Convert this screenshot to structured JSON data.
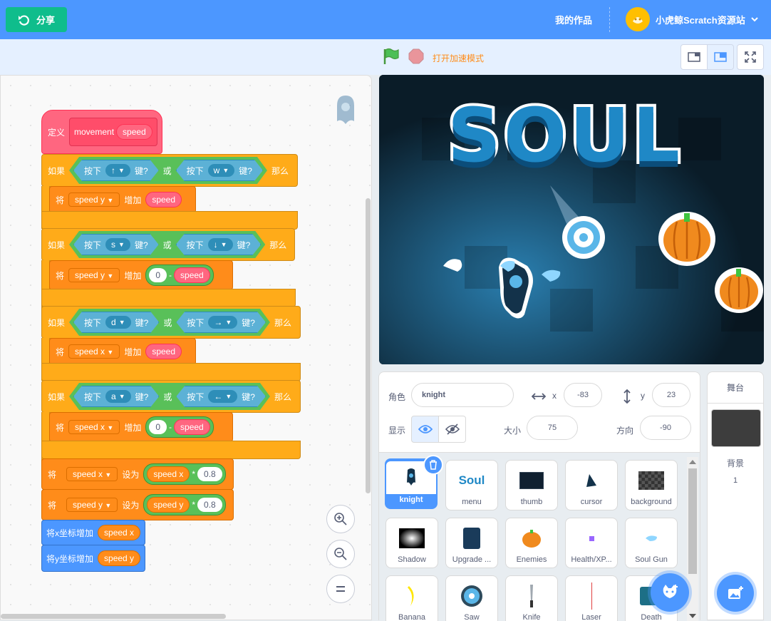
{
  "topbar": {
    "share_label": "分享",
    "my_works_label": "我的作品",
    "username": "小虎鲸Scratch资源站"
  },
  "controls": {
    "turbo_label": "打开加速模式"
  },
  "code": {
    "define": {
      "label": "定义",
      "name": "movement",
      "param": "speed"
    },
    "if1": {
      "if": "如果",
      "press": "按下",
      "key1": "↑",
      "key_word": "键?",
      "or": "或",
      "press2": "按下",
      "key2": "w",
      "key_word2": "键?",
      "then": "那么"
    },
    "change1": {
      "set": "将",
      "var": "speed y",
      "op": "增加",
      "value": "speed"
    },
    "if2": {
      "if": "如果",
      "press": "按下",
      "key1": "s",
      "key_word": "键?",
      "or": "或",
      "press2": "按下",
      "key2": "↓",
      "key_word2": "键?",
      "then": "那么"
    },
    "change2": {
      "set": "将",
      "var": "speed y",
      "op": "增加",
      "num": "0",
      "minus": "-",
      "value": "speed"
    },
    "if3": {
      "if": "如果",
      "press": "按下",
      "key1": "d",
      "key_word": "键?",
      "or": "或",
      "press2": "按下",
      "key2": "→",
      "key_word2": "键?",
      "then": "那么"
    },
    "change3": {
      "set": "将",
      "var": "speed x",
      "op": "增加",
      "value": "speed"
    },
    "if4": {
      "if": "如果",
      "press": "按下",
      "key1": "a",
      "key_word": "键?",
      "or": "或",
      "press2": "按下",
      "key2": "←",
      "key_word2": "键?",
      "then": "那么"
    },
    "change4": {
      "set": "将",
      "var": "speed x",
      "op": "增加",
      "num": "0",
      "minus": "-",
      "value": "speed"
    },
    "set1": {
      "set": "将",
      "var": "speed x",
      "op": "设为",
      "value": "speed x",
      "times": "*",
      "num": "0.8"
    },
    "set2": {
      "set": "将",
      "var": "speed y",
      "op": "设为",
      "value": "speed y",
      "times": "*",
      "num": "0.8"
    },
    "movex": {
      "label": "将x坐标增加",
      "value": "speed x"
    },
    "movey": {
      "label": "将y坐标增加",
      "value": "speed y"
    }
  },
  "stage": {
    "title": "SOUL"
  },
  "sprite_info": {
    "sprite_label": "角色",
    "sprite_name": "knight",
    "x_label": "x",
    "x_value": "-83",
    "y_label": "y",
    "y_value": "23",
    "show_label": "显示",
    "size_label": "大小",
    "size_value": "75",
    "direction_label": "方向",
    "direction_value": "-90"
  },
  "sprites": [
    {
      "name": "knight"
    },
    {
      "name": "menu"
    },
    {
      "name": "thumb"
    },
    {
      "name": "cursor"
    },
    {
      "name": "background"
    },
    {
      "name": "Shadow"
    },
    {
      "name": "Upgrade ..."
    },
    {
      "name": "Enemies"
    },
    {
      "name": "Health/XP..."
    },
    {
      "name": "Soul Gun"
    },
    {
      "name": "Banana"
    },
    {
      "name": "Saw"
    },
    {
      "name": "Knife"
    },
    {
      "name": "Laser"
    },
    {
      "name": "Death"
    }
  ],
  "thumb_texts": {
    "menu": "Soul"
  },
  "stage_panel": {
    "title": "舞台",
    "backdrop_label": "背景",
    "backdrop_count": "1"
  },
  "colors": {
    "accent": "#4c97ff",
    "share": "#0fbd8c",
    "turbo": "#ff8c1a"
  }
}
